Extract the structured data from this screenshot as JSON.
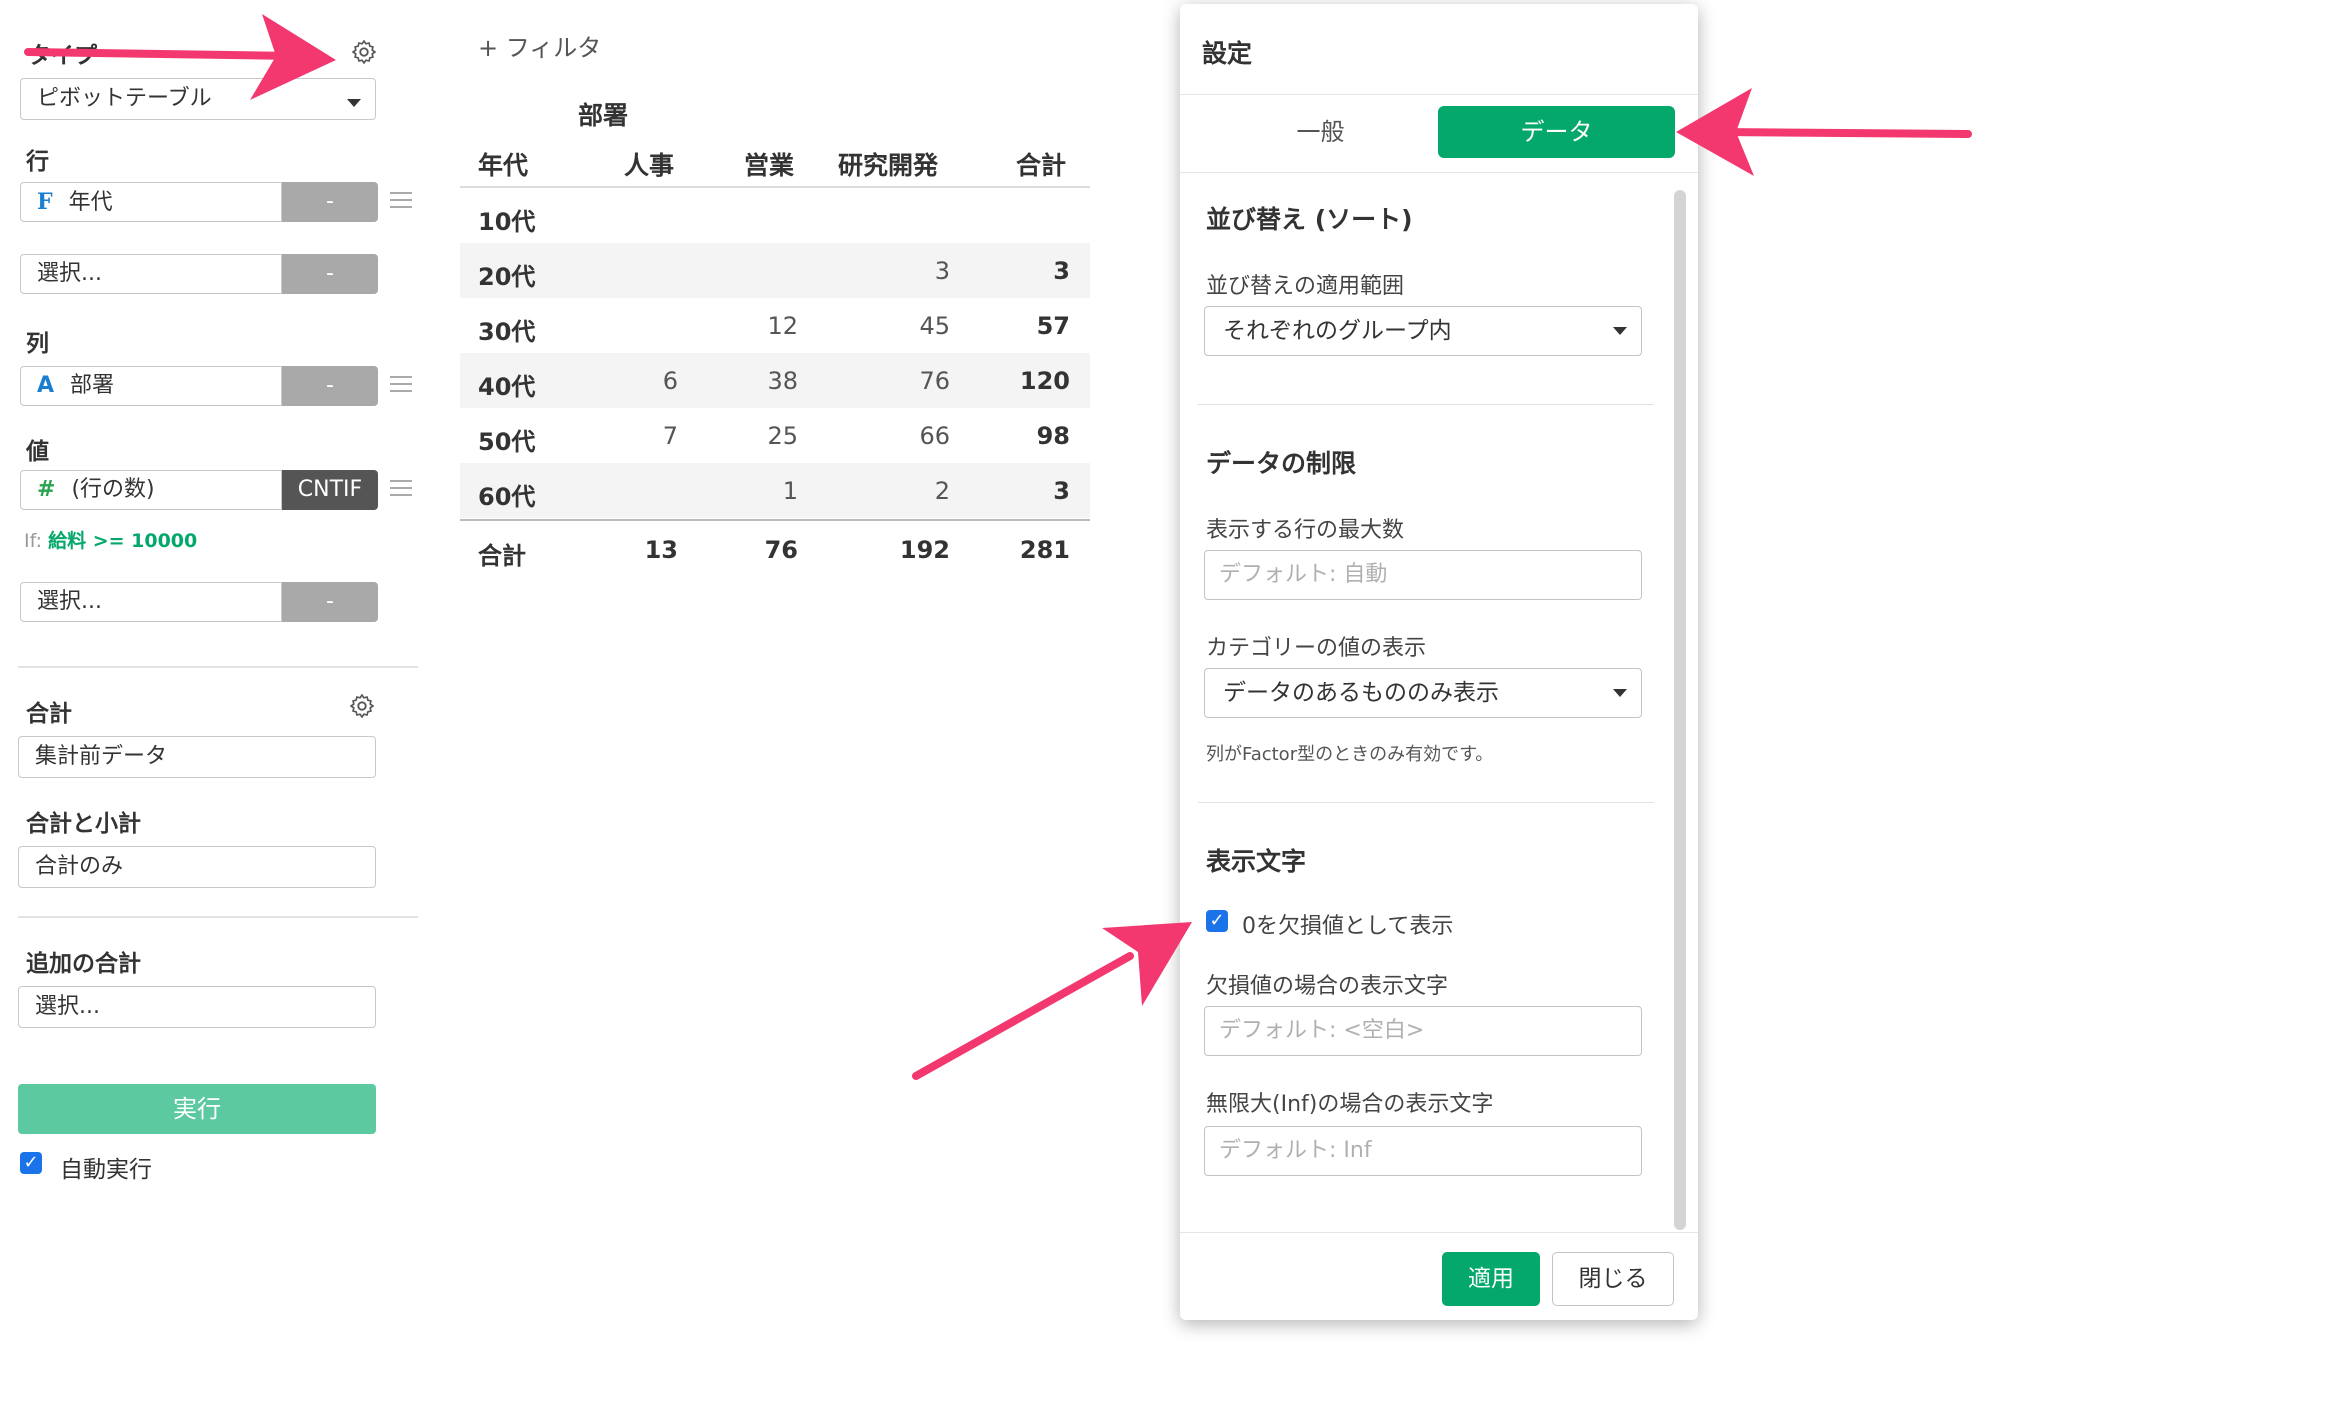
{
  "left": {
    "type_label": "タイプ",
    "type_value": "ピボットテーブル",
    "row_label": "行",
    "row_field": {
      "icon": "F",
      "name": "年代",
      "btn": "-"
    },
    "row_select": {
      "placeholder": "選択...",
      "btn": "-"
    },
    "col_label": "列",
    "col_field": {
      "icon": "A",
      "name": "部署",
      "btn": "-"
    },
    "value_label": "値",
    "value_field": {
      "icon": "#",
      "name": "(行の数)",
      "btn": "CNTIF"
    },
    "filter_prefix": "If:",
    "filter_expr": "給料 >= 10000",
    "value_select": {
      "placeholder": "選択...",
      "btn": "-"
    },
    "total_label": "合計",
    "total_value": "集計前データ",
    "subtotal_label": "合計と小計",
    "subtotal_value": "合計のみ",
    "extra_total_label": "追加の合計",
    "extra_total_value": "選択...",
    "run_button": "実行",
    "auto_run_label": "自動実行"
  },
  "filter_button": "+ フィルタ",
  "pivot": {
    "column_group": "部署",
    "headers": [
      "年代",
      "人事",
      "営業",
      "研究開発",
      "合計"
    ],
    "rows": [
      {
        "label": "10代",
        "values": [
          "",
          "",
          "",
          ""
        ]
      },
      {
        "label": "20代",
        "values": [
          "",
          "",
          "3",
          "3"
        ]
      },
      {
        "label": "30代",
        "values": [
          "",
          "12",
          "45",
          "57"
        ]
      },
      {
        "label": "40代",
        "values": [
          "6",
          "38",
          "76",
          "120"
        ]
      },
      {
        "label": "50代",
        "values": [
          "7",
          "25",
          "66",
          "98"
        ]
      },
      {
        "label": "60代",
        "values": [
          "",
          "1",
          "2",
          "3"
        ]
      }
    ],
    "total_row": {
      "label": "合計",
      "values": [
        "13",
        "76",
        "192",
        "281"
      ]
    }
  },
  "dialog": {
    "title": "設定",
    "tabs": [
      "一般",
      "データ"
    ],
    "sort_heading": "並び替え (ソート)",
    "sort_scope_label": "並び替えの適用範囲",
    "sort_scope_value": "それぞれのグループ内",
    "limit_heading": "データの制限",
    "max_rows_label": "表示する行の最大数",
    "max_rows_placeholder": "デフォルト: 自動",
    "category_label": "カテゴリーの値の表示",
    "category_value": "データのあるもののみ表示",
    "category_note": "列がFactor型のときのみ有効です。",
    "display_heading": "表示文字",
    "zero_as_na_label": "0を欠損値として表示",
    "na_text_label": "欠損値の場合の表示文字",
    "na_text_placeholder": "デフォルト: <空白>",
    "inf_text_label": "無限大(Inf)の場合の表示文字",
    "inf_text_placeholder": "デフォルト: Inf",
    "apply_button": "適用",
    "close_button": "閉じる"
  },
  "colors": {
    "accent_green": "#04a86b",
    "run_button": "#5cc9a0",
    "arrow_pink": "#f2386f",
    "checkbox_blue": "#1a73e8"
  }
}
